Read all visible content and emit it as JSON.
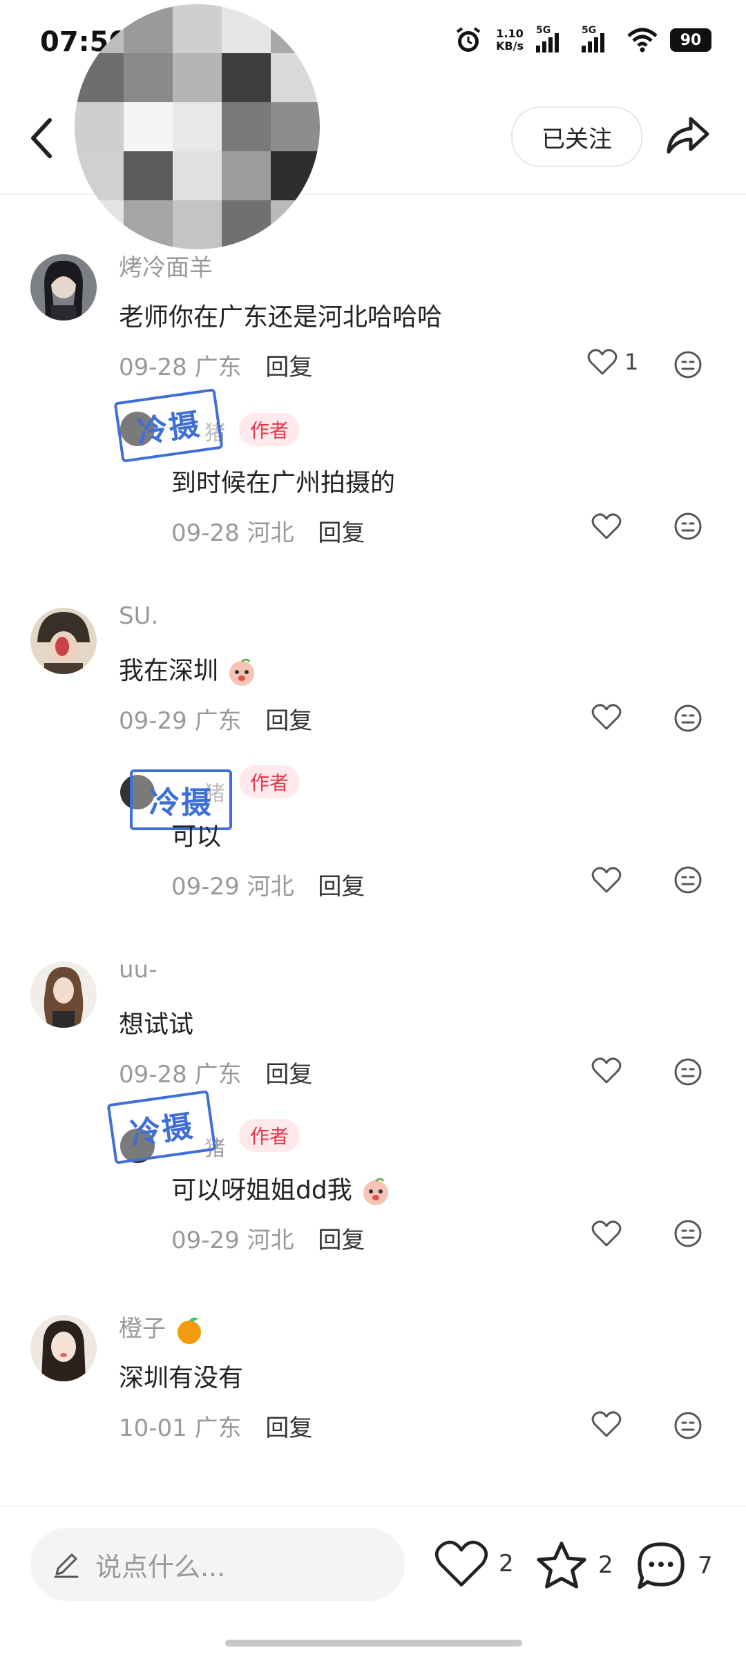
{
  "status_bar": {
    "time": "07:50",
    "speed_value": "1.10",
    "speed_unit": "KB/s",
    "network_1": "5G",
    "network_2": "5G",
    "battery": "90"
  },
  "header": {
    "follow_label": "已关注"
  },
  "comments": [
    {
      "name": "烤冷面羊",
      "text": "老师你在广东还是河北哈哈哈",
      "date": "09-28",
      "location": "广东",
      "reply_label": "回复",
      "likes": "1",
      "reply": {
        "name": "猪",
        "tag": "作者",
        "text": "到时候在广州拍摄的",
        "date": "09-28",
        "location": "河北",
        "reply_label": "回复"
      }
    },
    {
      "name": "SU.",
      "text": "我在深圳",
      "date": "09-29",
      "location": "广东",
      "reply_label": "回复",
      "likes": "",
      "reply": {
        "name": "猪",
        "tag": "作者",
        "text": "可以",
        "date": "09-29",
        "location": "河北",
        "reply_label": "回复"
      }
    },
    {
      "name": "uu-",
      "text": "想试试",
      "date": "09-28",
      "location": "广东",
      "reply_label": "回复",
      "likes": "",
      "reply": {
        "name": "猪",
        "tag": "作者",
        "text": "可以呀姐姐dd我",
        "date": "09-29",
        "location": "河北",
        "reply_label": "回复"
      }
    },
    {
      "name": "橙子",
      "text": "深圳有没有",
      "date": "10-01",
      "location": "广东",
      "reply_label": "回复",
      "likes": ""
    }
  ],
  "watermark": {
    "text": "冷摄"
  },
  "bottom_bar": {
    "input_placeholder": "说点什么...",
    "like_count": "2",
    "star_count": "2",
    "comment_count": "7"
  },
  "icons": {
    "back": "chevron-left-icon",
    "share": "share-arrow-icon",
    "like": "heart-icon",
    "dislike": "meh-face-icon",
    "star": "star-icon",
    "comment": "chat-bubble-icon",
    "pen": "pencil-icon"
  },
  "colors": {
    "author_tag_bg": "#ffe9ec",
    "author_tag_text": "#e5344a",
    "stamp": "#3f6fd6"
  }
}
